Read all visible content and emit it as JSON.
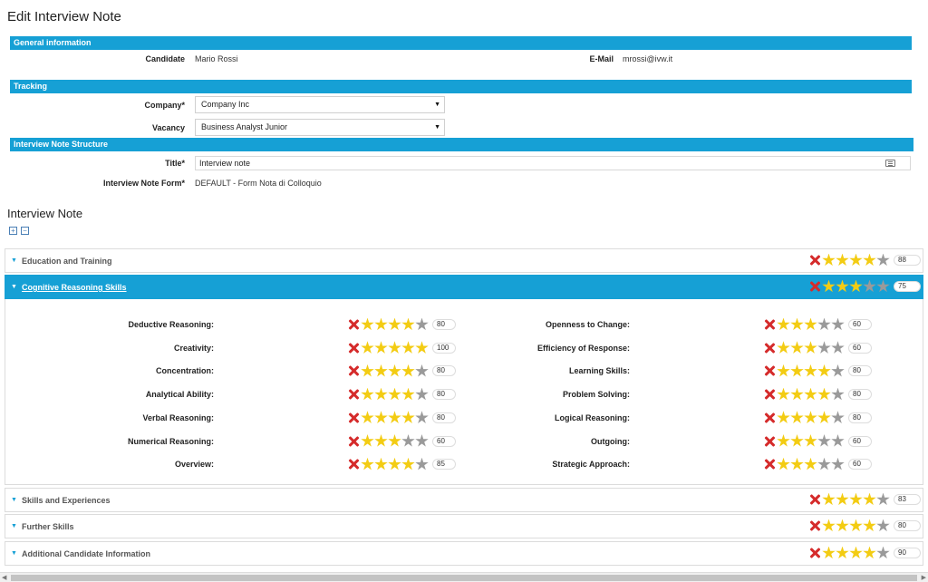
{
  "page": {
    "title": "Edit Interview Note"
  },
  "general": {
    "header": "General information",
    "candidate_label": "Candidate",
    "candidate_value": "Mario Rossi",
    "email_label": "E-Mail",
    "email_value": "mrossi@ivw.it"
  },
  "tracking": {
    "header": "Tracking",
    "company_label": "Company*",
    "company_value": "Company Inc",
    "vacancy_label": "Vacancy",
    "vacancy_value": "Business Analyst Junior"
  },
  "structure": {
    "header": "Interview Note Structure",
    "title_label": "Title*",
    "title_value": "Interview note",
    "form_label": "Interview Note Form*",
    "form_value": "DEFAULT - Form Nota di Colloquio"
  },
  "interview_note": {
    "title": "Interview Note",
    "expand_icon": "plus-square-icon",
    "collapse_icon": "minus-square-icon"
  },
  "sections": [
    {
      "title": "Education and Training",
      "stars": 4,
      "score": "88",
      "expanded": false
    },
    {
      "title": "Cognitive Reasoning Skills",
      "stars": 3,
      "score": "75",
      "expanded": true
    },
    {
      "title": "Skills and Experiences",
      "stars": 4,
      "score": "83",
      "expanded": false
    },
    {
      "title": "Further Skills",
      "stars": 4,
      "score": "80",
      "expanded": false
    },
    {
      "title": "Additional Candidate Information",
      "stars": 4,
      "score": "90",
      "expanded": false
    }
  ],
  "criteria_left": [
    {
      "label": "Deductive Reasoning:",
      "stars": 4,
      "score": "80"
    },
    {
      "label": "Creativity:",
      "stars": 5,
      "score": "100"
    },
    {
      "label": "Concentration:",
      "stars": 4,
      "score": "80"
    },
    {
      "label": "Analytical Ability:",
      "stars": 4,
      "score": "80"
    },
    {
      "label": "Verbal Reasoning:",
      "stars": 4,
      "score": "80"
    },
    {
      "label": "Numerical Reasoning:",
      "stars": 3,
      "score": "60"
    },
    {
      "label": "Overview:",
      "stars": 4,
      "score": "85"
    }
  ],
  "criteria_right": [
    {
      "label": "Openness to Change:",
      "stars": 3,
      "score": "60"
    },
    {
      "label": "Efficiency of Response:",
      "stars": 3,
      "score": "60"
    },
    {
      "label": "Learning Skills:",
      "stars": 4,
      "score": "80"
    },
    {
      "label": "Problem Solving:",
      "stars": 4,
      "score": "80"
    },
    {
      "label": "Logical Reasoning:",
      "stars": 4,
      "score": "80"
    },
    {
      "label": "Outgoing:",
      "stars": 3,
      "score": "60"
    },
    {
      "label": "Strategic Approach:",
      "stars": 3,
      "score": "60"
    }
  ],
  "colors": {
    "accent": "#16a0d5",
    "star_on": "#f3cc13",
    "star_off": "#9a9a9a",
    "clear": "#d52b2b"
  },
  "icons": {
    "clear": "clear-rating-x-icon",
    "star": "star-icon",
    "chevron": "chevron-down-icon",
    "edit": "edit-form-icon"
  }
}
